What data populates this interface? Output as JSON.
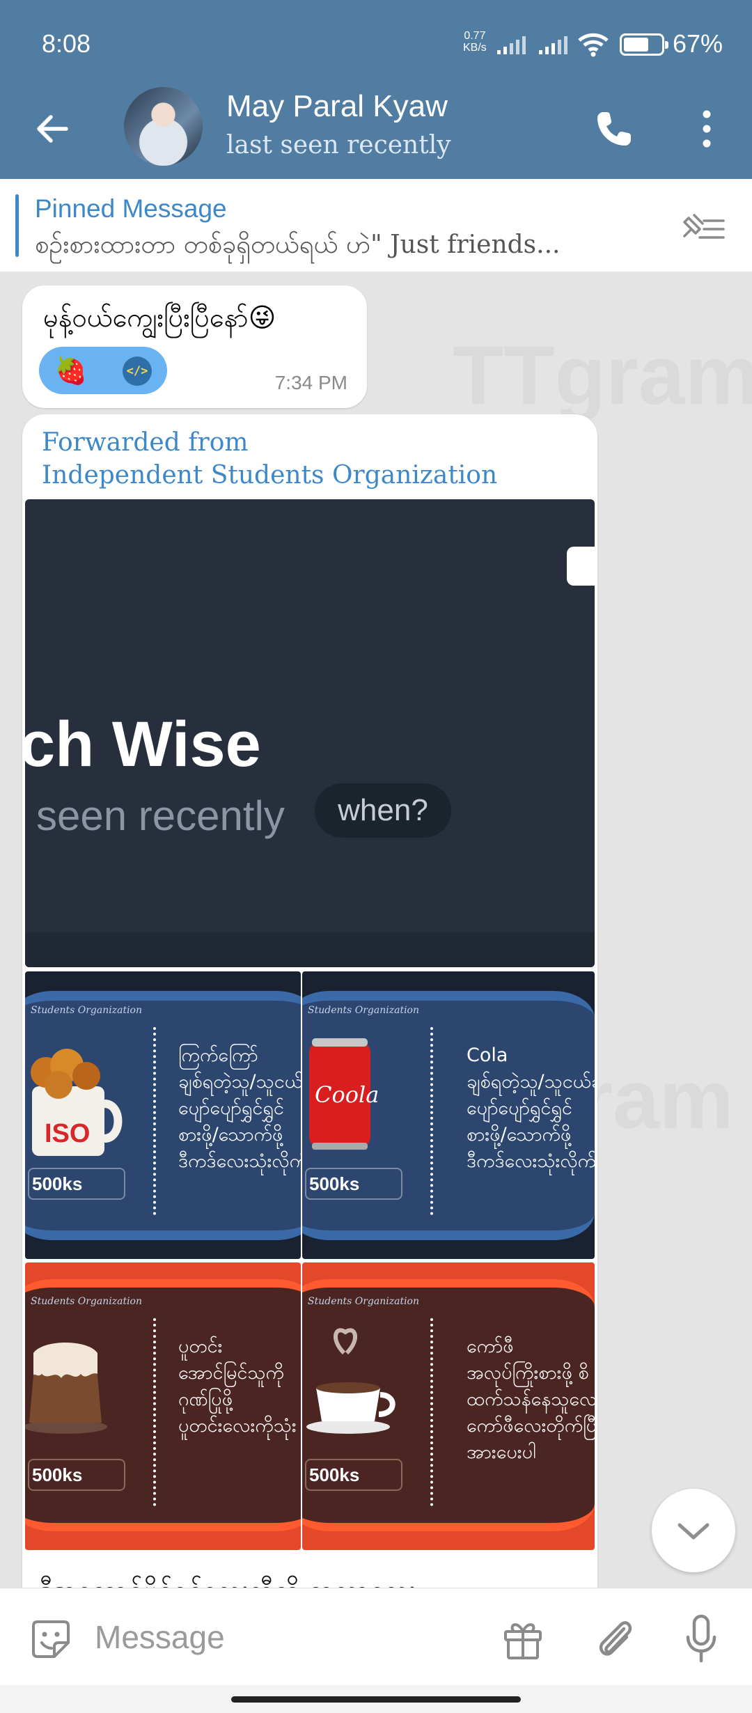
{
  "status_bar": {
    "time": "8:08",
    "net_speed_value": "0.77",
    "net_speed_unit": "KB/s",
    "battery_text": "67%",
    "battery_level": 0.67
  },
  "header": {
    "contact_name": "May Paral Kyaw",
    "last_seen": "last seen recently",
    "color": "#517da2"
  },
  "pinned": {
    "title": "Pinned Message",
    "text": "စဉ်းစားထားတာ တစ်ခုရှိတယ်ရယ် ဟဲ\" Just friends..."
  },
  "messages": [
    {
      "text": "မုန့်ဝယ်ကျွေးပြီးပြီနော်😜",
      "reaction_emoji": "🍓",
      "reaction_icon": "coder-icon",
      "time": "7:34 PM"
    },
    {
      "forwarded_label": "Forwarded from",
      "forwarded_from": "Independent Students Organization",
      "main_photo": {
        "big_text": "ch Wise",
        "sub_text": "seen recently",
        "pill": "when?"
      },
      "tiles": [
        {
          "org": "Students Organization",
          "price": "500ks",
          "lines": [
            "ကြက်ကြော်",
            "ချစ်ရတဲ့သူ/သူငယ်",
            "ပျော်ပျော်ရွှင်ရွှင်",
            "စားဖို့/သောက်ဖို့",
            "ဒီကဒ်လေးသုံးလိုက်"
          ]
        },
        {
          "org": "Students Organization",
          "price": "500ks",
          "lines": [
            "Cola",
            "ချစ်ရတဲ့သူ/သူငယ်ချ",
            "ပျော်ပျော်ရွှင်ရွှင်",
            "စားဖို့/သောက်ဖို့",
            "ဒီကဒ်လေးသုံးလိုက်ပါ"
          ]
        },
        {
          "org": "Students Organization",
          "price": "500ks",
          "lines": [
            "ပူတင်း",
            "အောင်မြင်သူကို",
            "ဂုဏ်ပြုဖို့",
            "ပူတင်းလေးကိုသုံး"
          ]
        },
        {
          "org": "Students Organization",
          "price": "500ks",
          "lines": [
            "ကော်ဖီ",
            "အလုပ်ကြိုးစားဖို့ စိ",
            "ထက်သန်နေသူလေး",
            "ကော်ဖီလေးတိုက်ပြီ",
            "အားပေးပါ"
          ]
        }
      ],
      "caption": "ဒီအကောင်ပိုင်ရင်လေးဆီကို စာလာလေး"
    }
  ],
  "input": {
    "placeholder": "Message"
  },
  "icons": {
    "back": "arrow-left-icon",
    "call": "phone-icon",
    "more": "more-vertical-icon",
    "pin": "pin-list-icon",
    "sticker": "sticker-icon",
    "gift": "gift-icon",
    "attach": "paperclip-icon",
    "mic": "microphone-icon",
    "scroll": "chevron-down-icon"
  }
}
